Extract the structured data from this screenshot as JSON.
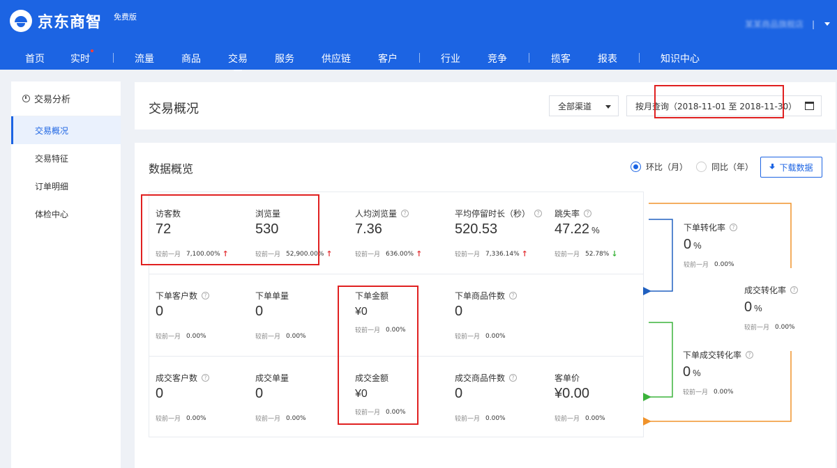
{
  "header": {
    "brand": "京东商智",
    "edition": "免费版",
    "user_name": "某某商品旗舰店",
    "separator": "|"
  },
  "nav": {
    "items": [
      "首页",
      "实时",
      "流量",
      "商品",
      "交易",
      "服务",
      "供应链",
      "客户",
      "行业",
      "竞争",
      "揽客",
      "报表",
      "知识中心"
    ],
    "active": "交易",
    "separator": "|"
  },
  "sidebar": {
    "heading": "交易分析",
    "items": [
      "交易概况",
      "交易特征",
      "订单明细",
      "体检中心"
    ],
    "active": "交易概况"
  },
  "page": {
    "title": "交易概况",
    "channel": "全部渠道",
    "date_range": "按月查询（2018-11-01 至 2018-11-30）"
  },
  "overview": {
    "title": "数据概览",
    "radio_mom": "环比（月）",
    "radio_yoy": "同比（年）",
    "download": "下载数据",
    "compare_label": "较前一月",
    "help": "?"
  },
  "metrics": {
    "row1": [
      {
        "label": "访客数",
        "value": "72",
        "pct": "7,100.00%",
        "trend": "up"
      },
      {
        "label": "浏览量",
        "value": "530",
        "pct": "52,900.00%",
        "trend": "up"
      },
      {
        "label": "人均浏览量",
        "value": "7.36",
        "pct": "636.00%",
        "trend": "up"
      },
      {
        "label": "平均停留时长（秒）",
        "value": "520.53",
        "pct": "7,336.14%",
        "trend": "up"
      },
      {
        "label": "跳失率",
        "value": "47.22",
        "unit": "%",
        "pct": "52.78%",
        "trend": "down"
      }
    ],
    "row2": [
      {
        "label": "下单客户数",
        "value": "0",
        "pct": "0.00%"
      },
      {
        "label": "下单单量",
        "value": "0",
        "pct": "0.00%"
      },
      {
        "label": "下单金额",
        "value": "¥0",
        "pct": "0.00%"
      },
      {
        "label": "下单商品件数",
        "value": "0",
        "pct": "0.00%"
      }
    ],
    "row3": [
      {
        "label": "成交客户数",
        "value": "0",
        "pct": "0.00%"
      },
      {
        "label": "成交单量",
        "value": "0",
        "pct": "0.00%"
      },
      {
        "label": "成交金额",
        "value": "¥0",
        "pct": "0.00%"
      },
      {
        "label": "成交商品件数",
        "value": "0",
        "pct": "0.00%"
      },
      {
        "label": "客单价",
        "value": "¥0.00",
        "pct": "0.00%"
      }
    ]
  },
  "conversion": {
    "order_rate": {
      "label": "下单转化率",
      "value": "0",
      "unit": "%",
      "pct": "0.00%"
    },
    "deal_rate": {
      "label": "成交转化率",
      "value": "0",
      "unit": "%",
      "pct": "0.00%"
    },
    "order_deal_rate": {
      "label": "下单成交转化率",
      "value": "0",
      "unit": "%",
      "pct": "0.00%"
    }
  },
  "colors": {
    "brand_blue": "#1c64e3",
    "flow_orange": "#f0932b",
    "flow_blue": "#2060c0",
    "flow_green": "#3bb33b",
    "highlight_red": "#e02020"
  }
}
